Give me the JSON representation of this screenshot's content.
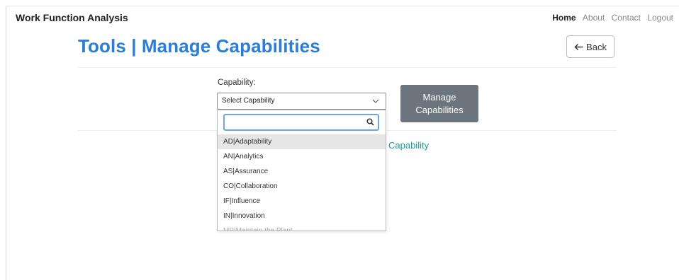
{
  "navbar": {
    "brand": "Work Function Analysis",
    "links": [
      "Home",
      "About",
      "Contact",
      "Logout"
    ],
    "active": "Home"
  },
  "page": {
    "title": "Tools | Manage Capabilities",
    "back_label": "Back",
    "capability_label": "Capability:",
    "selected_value": "Select Capability",
    "manage_button_line1": "Manage",
    "manage_button_line2": "Capabilities",
    "behind_text": "Capability"
  },
  "dropdown": {
    "search_value": "",
    "options": [
      "AD|Adaptability",
      "AN|Analytics",
      "AS|Assurance",
      "CO|Collaboration",
      "IF|Influence",
      "IN|Innovation",
      "MP|Maintain the Plant"
    ],
    "highlighted_index": 0
  },
  "colors": {
    "title": "#2a7ed8",
    "manage_button": "#6c757d",
    "behind_text": "#1a9a9a",
    "search_focus": "#6aa6e8"
  },
  "icons": {
    "back": "arrow-left-icon",
    "select": "chevron-down-icon",
    "search": "search-icon"
  }
}
